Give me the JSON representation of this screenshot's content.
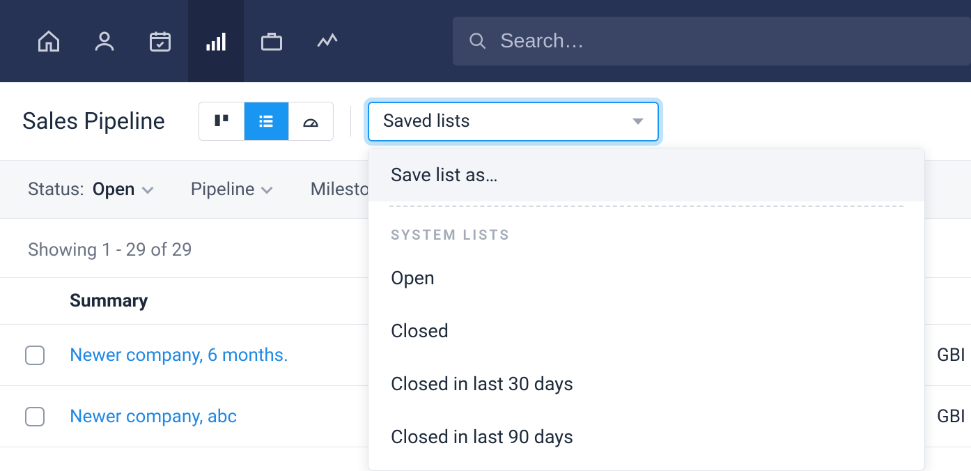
{
  "nav": {
    "icons": [
      "home",
      "person",
      "calendar",
      "pipeline",
      "briefcase",
      "trend"
    ],
    "active_index": 3,
    "search_placeholder": "Search…"
  },
  "page": {
    "title": "Sales Pipeline",
    "view_buttons": [
      "board",
      "list",
      "dashboard"
    ],
    "active_view_index": 1
  },
  "saved_lists": {
    "button_label": "Saved lists",
    "dropdown": {
      "save_as_label": "Save list as…",
      "section_heading": "SYSTEM LISTS",
      "items": [
        "Open",
        "Closed",
        "Closed in last 30 days",
        "Closed in last 90 days"
      ]
    }
  },
  "filters": {
    "status_label": "Status:",
    "status_value": "Open",
    "pipeline_label": "Pipeline",
    "milestone_label": "Milesto"
  },
  "table": {
    "showing_text": "Showing 1 - 29 of 29",
    "columns": {
      "summary": "Summary"
    },
    "rows": [
      {
        "summary": "Newer company, 6 months.",
        "right": "GBI"
      },
      {
        "summary": "Newer company, abc",
        "right": "GBI"
      }
    ]
  }
}
